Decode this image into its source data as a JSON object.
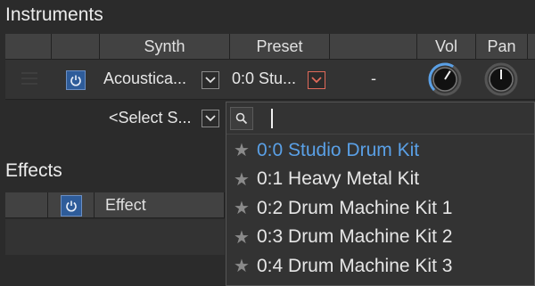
{
  "instruments": {
    "title": "Instruments",
    "columns": {
      "synth": "Synth",
      "preset": "Preset",
      "vol": "Vol",
      "pan": "Pan"
    },
    "row": {
      "synth": "Acoustica...",
      "preset": "0:0 Stu...",
      "extra": "-",
      "vol_level": 0.62,
      "pan_level": 0.5
    },
    "new_row": {
      "synth_placeholder": "<Select S..."
    }
  },
  "effects": {
    "title": "Effects",
    "columns": {
      "effect": "Effect"
    }
  },
  "preset_dropdown": {
    "search_value": "",
    "options": [
      {
        "label": "0:0 Studio Drum Kit",
        "selected": true
      },
      {
        "label": "0:1 Heavy Metal Kit",
        "selected": false
      },
      {
        "label": "0:2 Drum Machine Kit 1",
        "selected": false
      },
      {
        "label": "0:3 Drum Machine Kit 2",
        "selected": false
      },
      {
        "label": "0:4 Drum Machine Kit 3",
        "selected": false
      }
    ]
  },
  "colors": {
    "accent": "#5aa0e6",
    "power_blue": "#2e5c9a",
    "dropdown_arrow_red": "#e06a5a",
    "panel": "#2b2b2b",
    "header": "#424242"
  },
  "icons": {
    "power": "power-icon",
    "chevron": "chevron-down-icon",
    "search": "search-icon",
    "star": "star-icon",
    "drag": "drag-handle-icon"
  }
}
